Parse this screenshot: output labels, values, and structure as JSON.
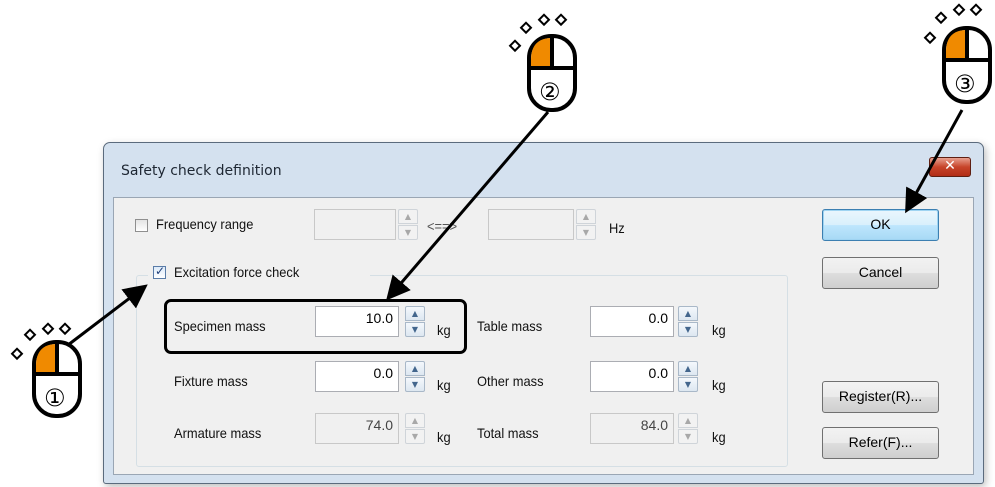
{
  "dialog": {
    "title": "Safety check definition",
    "close_glyph": "✕"
  },
  "frequency": {
    "label": "Frequency range",
    "checked": false,
    "from_value": "",
    "separator": "<==>",
    "to_value": "",
    "unit": "Hz"
  },
  "excitation": {
    "label": "Excitation force check",
    "checked": true
  },
  "masses": {
    "specimen": {
      "label": "Specimen mass",
      "value": "10.0",
      "unit": "kg"
    },
    "table": {
      "label": "Table mass",
      "value": "0.0",
      "unit": "kg"
    },
    "fixture": {
      "label": "Fixture  mass",
      "value": "0.0",
      "unit": "kg"
    },
    "other": {
      "label": "Other mass",
      "value": "0.0",
      "unit": "kg"
    },
    "armature": {
      "label": "Armature mass",
      "value": "74.0",
      "unit": "kg"
    },
    "total": {
      "label": "Total mass",
      "value": "84.0",
      "unit": "kg"
    }
  },
  "buttons": {
    "ok": "OK",
    "cancel": "Cancel",
    "register": "Register(R)...",
    "refer": "Refer(F)..."
  },
  "callouts": [
    {
      "number": "①",
      "icon": "mouse-left-click-icon"
    },
    {
      "number": "②",
      "icon": "mouse-left-click-icon"
    },
    {
      "number": "③",
      "icon": "mouse-left-click-icon"
    }
  ],
  "colors": {
    "mouse_button_accent": "#f08a00",
    "highlight": "#000000"
  }
}
